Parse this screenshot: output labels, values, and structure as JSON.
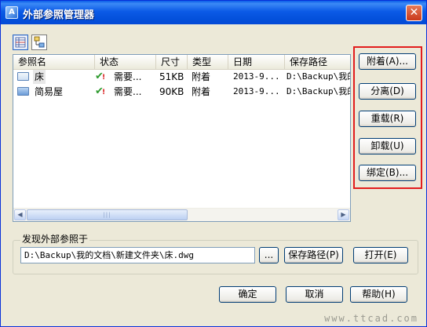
{
  "window": {
    "title": "外部参照管理器",
    "close_glyph": "✕"
  },
  "columns": [
    "参照名",
    "状态",
    "尺寸",
    "类型",
    "日期",
    "保存路径"
  ],
  "rows": [
    {
      "name": "床",
      "status": "需要...",
      "size": "51KB",
      "type": "附着",
      "date": "2013-9...",
      "path": "D:\\Backup\\我的"
    },
    {
      "name": "简易屋",
      "status": "需要...",
      "size": "90KB",
      "type": "附着",
      "date": "2013-9...",
      "path": "D:\\Backup\\我的"
    }
  ],
  "side_buttons": {
    "attach": "附着(A)...",
    "detach": "分离(D)",
    "reload": "重载(R)",
    "unload": "卸载(U)",
    "bind": "绑定(B)..."
  },
  "found_at": {
    "label": "发现外部参照于",
    "path": "D:\\Backup\\我的文档\\新建文件夹\\床.dwg",
    "browse": "...",
    "save_path": "保存路径(P)",
    "open": "打开(E)"
  },
  "dialog_buttons": {
    "ok": "确定",
    "cancel": "取消",
    "help": "帮助(H)"
  },
  "watermark": "www.ttcad.com",
  "colors": {
    "highlight_border": "#e21d1d",
    "titlebar": "#0a5ee8"
  }
}
